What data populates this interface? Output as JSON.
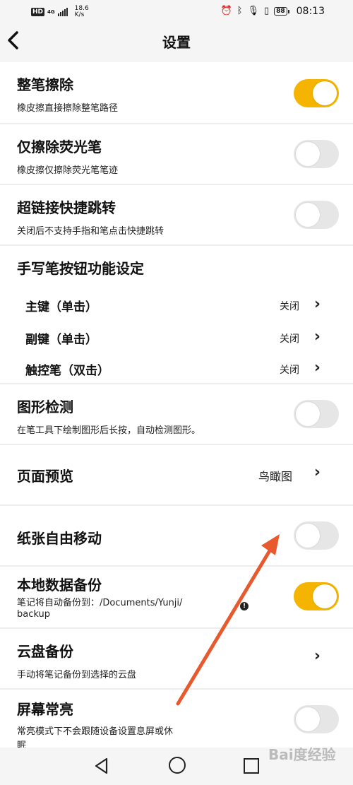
{
  "status_bar": {
    "hd": "HD",
    "network": "4G",
    "speed_value": "18.6",
    "speed_unit": "K/s",
    "battery": "88",
    "time": "08:13"
  },
  "header": {
    "title": "设置"
  },
  "settings": {
    "whole_erase": {
      "label": "整笔擦除",
      "sub": "橡皮擦直接擦除整笔路径",
      "enabled": true
    },
    "erase_highlighter": {
      "label": "仅擦除荧光笔",
      "sub": "橡皮擦仅擦除荧光笔笔迹",
      "enabled": false
    },
    "hyperlink_jump": {
      "label": "超链接快捷跳转",
      "sub": "关闭后不支持手指和笔点击快捷跳转",
      "enabled": false
    },
    "pen_button": {
      "label": "手写笔按钮功能设定",
      "items": [
        {
          "label": "主键（单击）",
          "value": "关闭"
        },
        {
          "label": "副键（单击）",
          "value": "关闭"
        },
        {
          "label": "触控笔（双击）",
          "value": "关闭"
        }
      ]
    },
    "shape_detect": {
      "label": "图形检测",
      "sub": "在笔工具下绘制图形后长按，自动检测图形。",
      "enabled": false
    },
    "page_preview": {
      "label": "页面预览",
      "value": "鸟瞰图"
    },
    "paper_free_move": {
      "label": "纸张自由移动",
      "enabled": false
    },
    "local_backup": {
      "label": "本地数据备份",
      "sub_line1": "笔记将自动备份到：/Documents/Yunji/",
      "sub_line2": "backup",
      "enabled": true
    },
    "cloud_backup": {
      "label": "云盘备份",
      "sub": "手动将笔记备份到选择的云盘"
    },
    "screen_on": {
      "label": "屏幕常亮",
      "sub_line1": "常亮模式下不会跟随设备设置息屏或休",
      "sub_line2": "眠",
      "enabled": false
    }
  },
  "watermark": "Bai度经验",
  "colors": {
    "accent": "#f4b400",
    "toggle_off": "#e6e6e6",
    "arrow": "#e8592d"
  }
}
